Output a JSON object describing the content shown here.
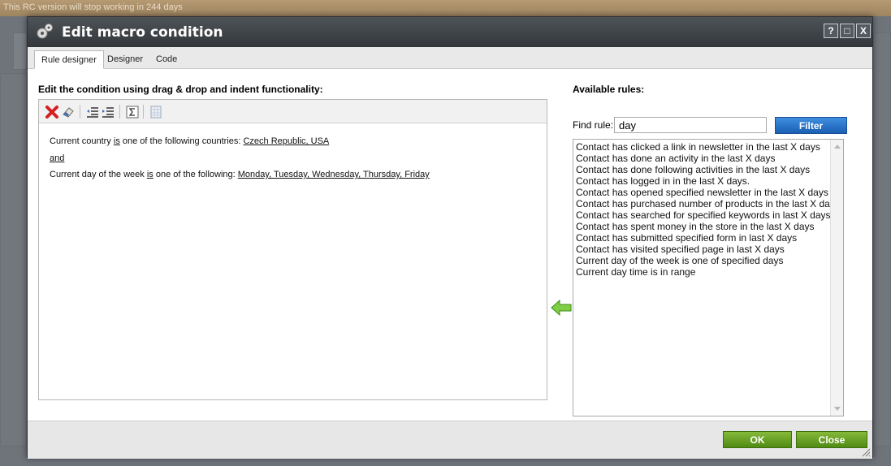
{
  "background": {
    "rc_notice": "This RC version will stop working in 244 days"
  },
  "dialog": {
    "title": "Edit macro condition",
    "buttons": {
      "help": "?",
      "maximize": "□",
      "close": "X"
    }
  },
  "tabs": [
    {
      "label": "Rule designer",
      "active": true
    },
    {
      "label": "Designer",
      "active": false
    },
    {
      "label": "Code",
      "active": false
    }
  ],
  "editor": {
    "heading": "Edit the condition using drag & drop and indent functionality:",
    "toolbar_icons": [
      "delete-icon",
      "eraser-icon",
      "indent-icon",
      "outdent-icon",
      "formula-icon",
      "grid-icon"
    ],
    "conditions": {
      "line1": {
        "prefix": "Current country ",
        "op": "is",
        "mid": " one of the following countries: ",
        "value": "Czech Republic, USA"
      },
      "operator": "and",
      "line2": {
        "prefix": "Current day of the week ",
        "op": "is",
        "mid": " one of the following: ",
        "value": "Monday, Tuesday, Wednesday, Thursday, Friday"
      }
    }
  },
  "rules_panel": {
    "heading": "Available rules:",
    "find_label": "Find rule:",
    "find_value": "day",
    "filter_label": "Filter",
    "rules": [
      "Contact has clicked a link in newsletter in the last X days",
      "Contact has done an activity in the last X days",
      "Contact has done following activities in the last X days",
      "Contact has logged in in the last X days.",
      "Contact has opened specified newsletter in the last X days",
      "Contact has purchased number of products in the last X days",
      "Contact has searched for specified keywords in last X days",
      "Contact has spent money in the store in the last X days",
      "Contact has submitted specified form in last X days",
      "Contact has visited specified page in last X days",
      "Current day of the week is one of specified days",
      "Current day time is in range"
    ]
  },
  "footer": {
    "ok_label": "OK",
    "close_label": "Close"
  },
  "colors": {
    "title_bar": "#3d4145",
    "filter_button": "#1f67bd",
    "action_button": "#5f9a1c",
    "arrow": "#6cbf3a"
  }
}
